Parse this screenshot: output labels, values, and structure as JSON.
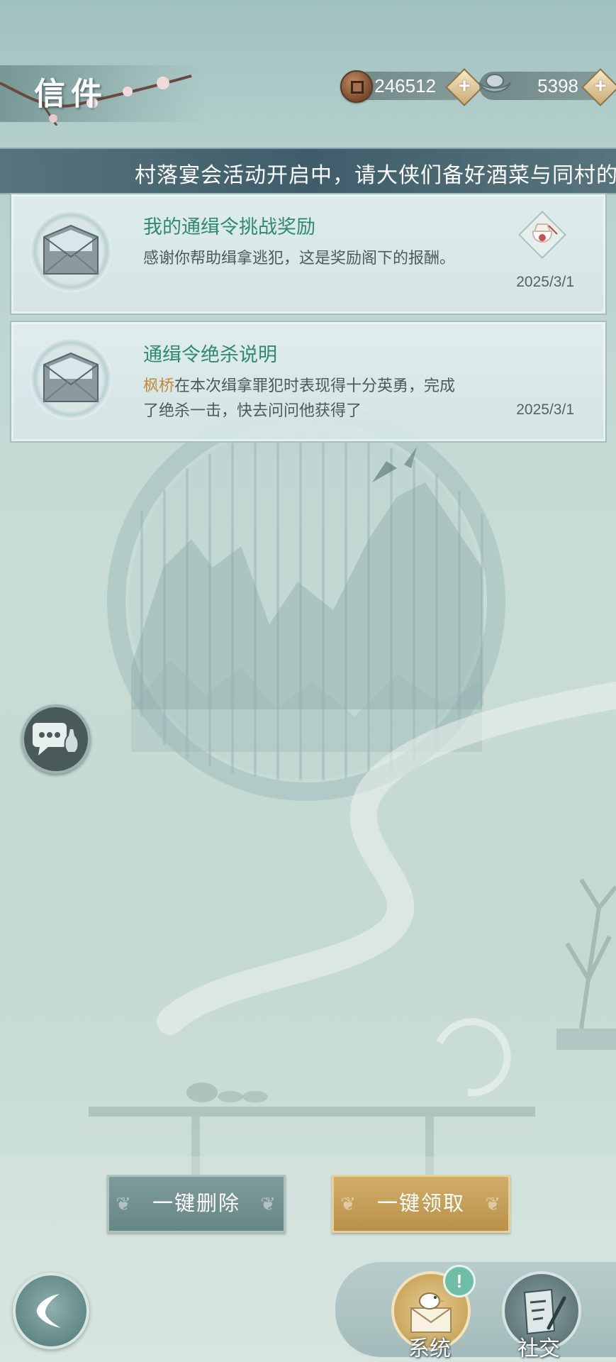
{
  "header": {
    "title": "信件",
    "copper": {
      "icon": "copper-coin-icon",
      "amount": "246512"
    },
    "silver": {
      "icon": "silver-ingot-icon",
      "amount": "5398"
    }
  },
  "marquee": {
    "text": "村落宴会活动开启中，请大侠们备好酒菜与同村的"
  },
  "mails": [
    {
      "title": "我的通缉令挑战奖励",
      "body": "感谢你帮助缉拿逃犯，这是奖励阁下的报酬。",
      "date": "2025/3/1",
      "icon": "envelope-icon",
      "reward_icon": "reward-pouch-icon"
    },
    {
      "title": "通缉令绝杀说明",
      "highlight": "枫桥",
      "body": "在本次缉拿罪犯时表现得十分英勇，完成了绝杀一击，快去问问他获得了",
      "date": "2025/3/1",
      "icon": "envelope-icon"
    }
  ],
  "actions": {
    "delete_all": "一键删除",
    "claim_all": "一键领取"
  },
  "tabs": {
    "system": "系统",
    "social": "社交",
    "system_badge": "!"
  },
  "colors": {
    "title_green": "#2f8a70",
    "highlight_gold": "#c08a3e",
    "claim_gold": "#c9a55d",
    "delete_gray": "#678686"
  }
}
